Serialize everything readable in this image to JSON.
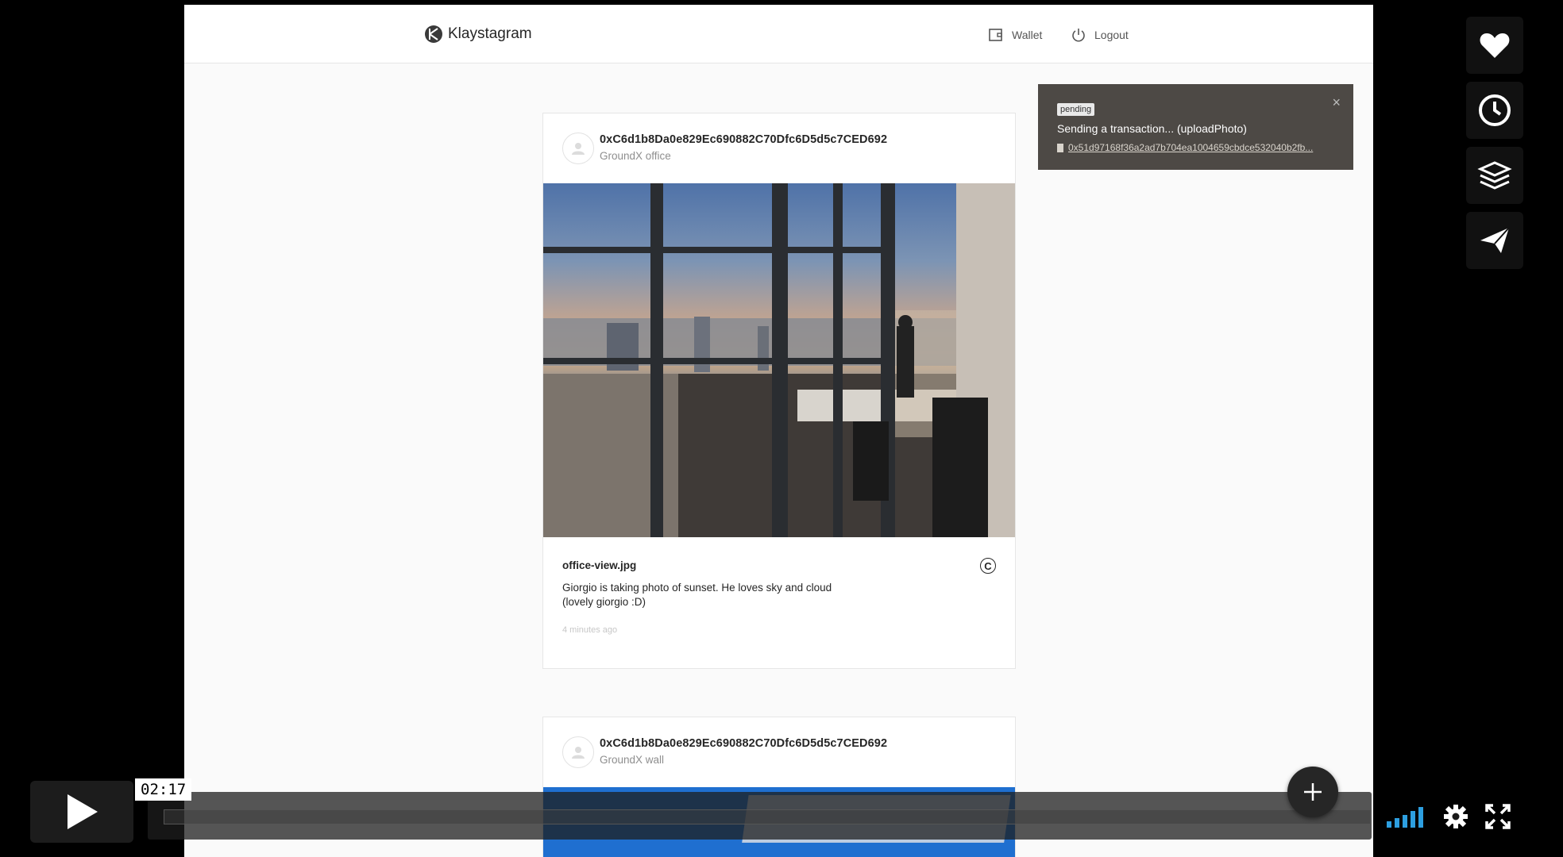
{
  "header": {
    "brand": "Klaystagram",
    "wallet_label": "Wallet",
    "logout_label": "Logout"
  },
  "toast": {
    "status": "pending",
    "message": "Sending a transaction... (uploadPhoto)",
    "tx_hash": "0x51d97168f36a2ad7b704ea1004659cbdce532040b2fb..."
  },
  "feed": [
    {
      "owner": "0xC6d1b8Da0e829Ec690882C70Dfc6D5d5c7CED692",
      "location": "GroundX office",
      "file_name": "office-view.jpg",
      "description_line1": "Giorgio is taking photo of sunset. He loves sky and cloud",
      "description_line2": "(lovely giorgio :D)",
      "time": "4 minutes ago"
    },
    {
      "owner": "0xC6d1b8Da0e829Ec690882C70Dfc6D5d5c7CED692",
      "location": "GroundX wall"
    }
  ],
  "player": {
    "current_time": "02:17",
    "progress": 0.0,
    "icons": [
      "heart-icon",
      "clock-icon",
      "layers-icon",
      "send-icon"
    ],
    "accent": "#2d9fe0"
  }
}
